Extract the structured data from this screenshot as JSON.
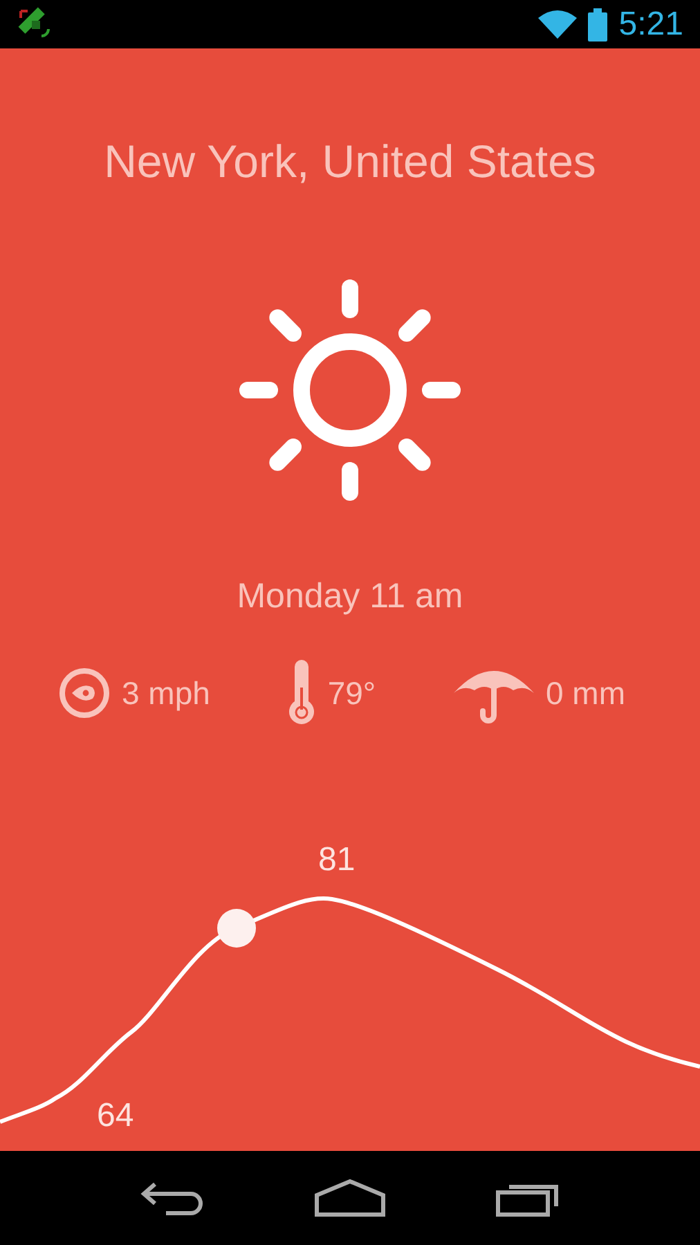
{
  "status_bar": {
    "time": "5:21"
  },
  "location": {
    "title": "New York, United States"
  },
  "current": {
    "icon": {
      "kind": "sun"
    },
    "time": "Monday 11 am"
  },
  "stats": [
    {
      "kind": "wind",
      "value": "3 mph"
    },
    {
      "kind": "temperature",
      "value": "79°"
    },
    {
      "kind": "rain",
      "value": "0 mm"
    }
  ],
  "forecast": {
    "high_label": "81",
    "low_label": "64"
  }
}
